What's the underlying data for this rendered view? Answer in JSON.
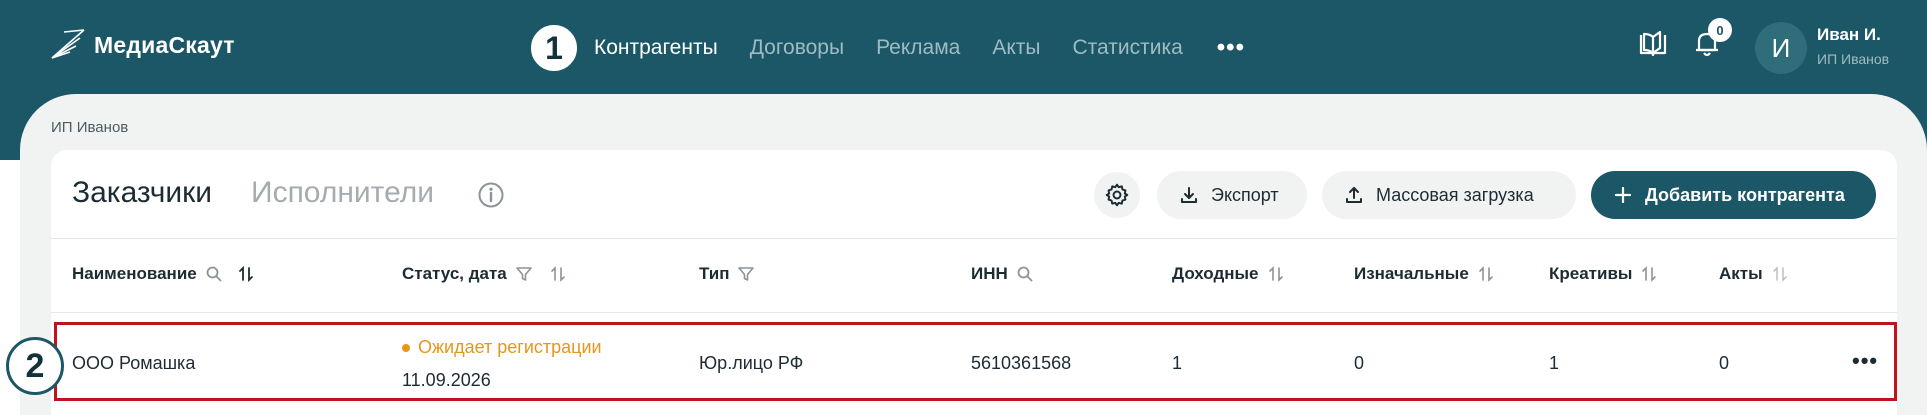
{
  "app": {
    "name": "МедиаСкаут"
  },
  "nav": {
    "step": "1",
    "items": [
      "Контрагенты",
      "Договоры",
      "Реклама",
      "Акты",
      "Статистика"
    ],
    "more": "•••"
  },
  "notifications": {
    "count": "0"
  },
  "user": {
    "initial": "И",
    "name": "Иван И.",
    "org": "ИП Иванов"
  },
  "breadcrumb": "ИП Иванов",
  "tabs": {
    "customers": "Заказчики",
    "contractors": "Исполнители"
  },
  "toolbar": {
    "export": "Экспорт",
    "bulk_upload": "Массовая загрузка",
    "add": "Добавить контрагента"
  },
  "table": {
    "headers": [
      "Наименование",
      "Статус, дата",
      "Тип",
      "ИНН",
      "Доходные",
      "Изначальные",
      "Креативы",
      "Акты"
    ],
    "row": {
      "step": "2",
      "name": "ООО Ромашка",
      "status": "Ожидает регистрации",
      "date": "11.09.2026",
      "type": "Юр.лицо РФ",
      "inn": "5610361568",
      "income": "1",
      "initial": "0",
      "creatives": "1",
      "acts": "0",
      "more": "•••"
    }
  },
  "colors": {
    "primary": "#1b5766",
    "status_pending": "#e8961a",
    "highlight": "#c0141c"
  }
}
